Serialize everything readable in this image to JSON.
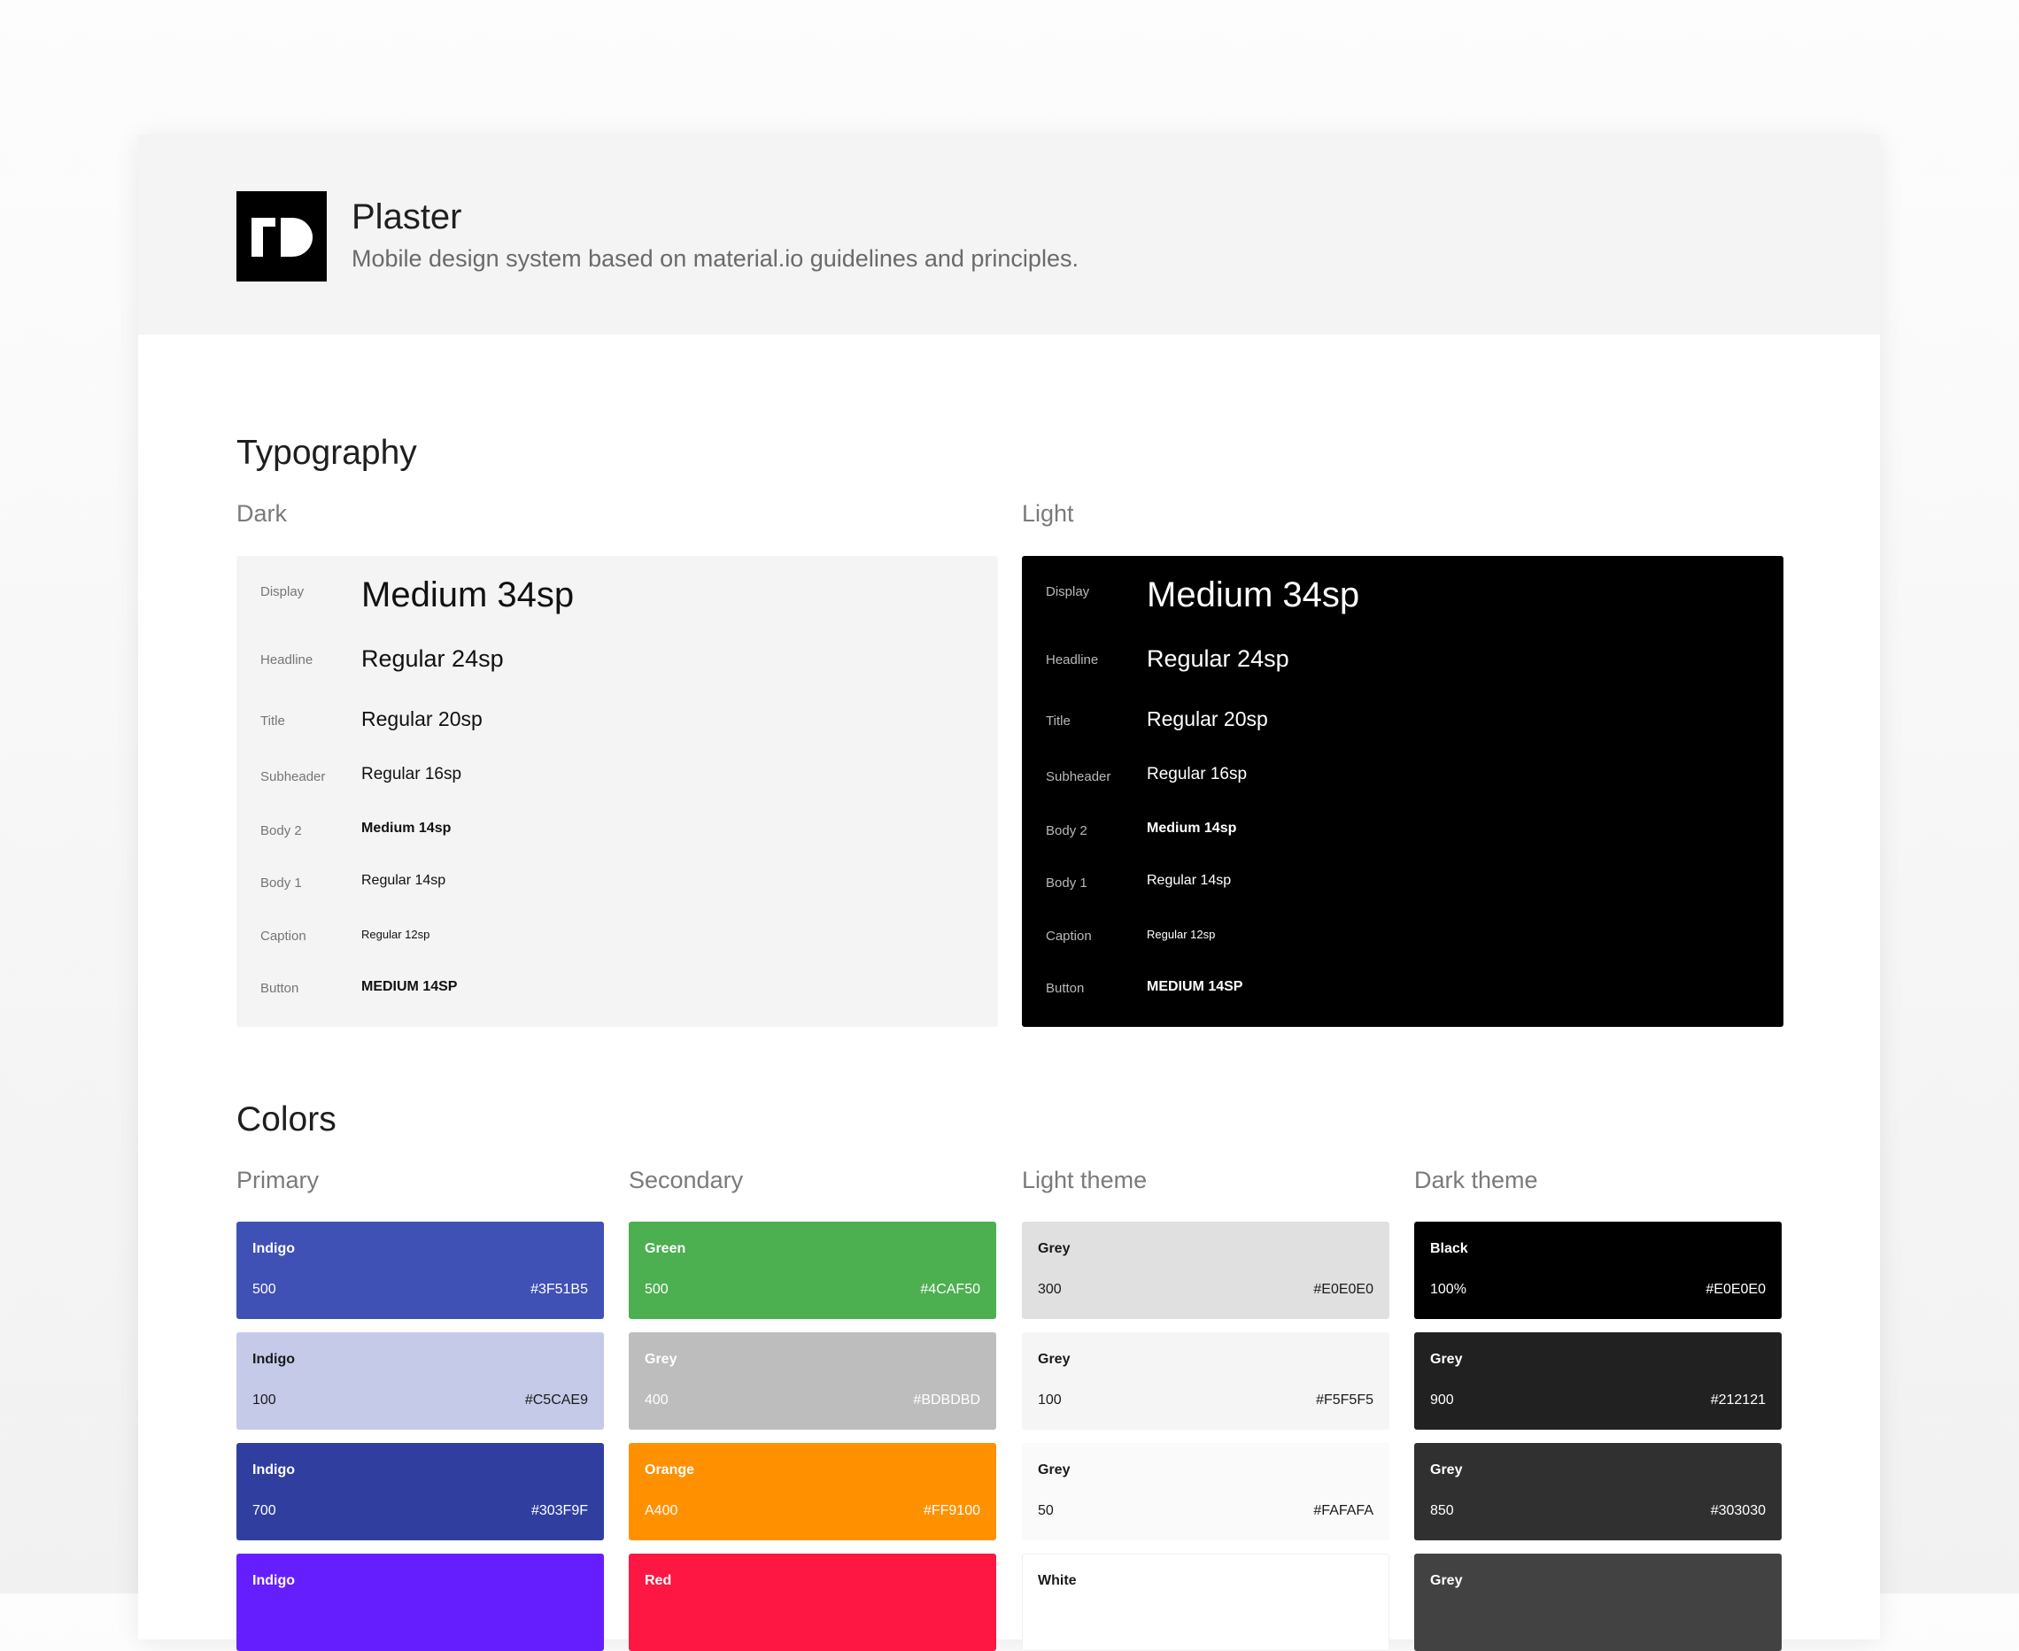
{
  "header": {
    "app_name": "Plaster",
    "description": "Mobile design system based on material.io guidelines and principles.",
    "logo_icon": "plaster-logo-icon"
  },
  "typography": {
    "title": "Typography",
    "dark_label": "Dark",
    "light_label": "Light",
    "rows": [
      {
        "label": "Display",
        "sample": "Medium 34sp"
      },
      {
        "label": "Headline",
        "sample": "Regular 24sp"
      },
      {
        "label": "Title",
        "sample": "Regular 20sp"
      },
      {
        "label": "Subheader",
        "sample": "Regular 16sp"
      },
      {
        "label": "Body 2",
        "sample": "Medium 14sp"
      },
      {
        "label": "Body 1",
        "sample": "Regular 14sp"
      },
      {
        "label": "Caption",
        "sample": "Regular 12sp"
      },
      {
        "label": "Button",
        "sample": "MEDIUM 14SP"
      }
    ]
  },
  "colors": {
    "title": "Colors",
    "groups": [
      {
        "label": "Primary",
        "swatches": [
          {
            "name": "Indigo",
            "shade": "500",
            "hex": "#3F51B5",
            "bg": "#3F51B5",
            "fg": "#ffffff"
          },
          {
            "name": "Indigo",
            "shade": "100",
            "hex": "#C5CAE9",
            "bg": "#C5CAE9",
            "fg": "#1a1a1a"
          },
          {
            "name": "Indigo",
            "shade": "700",
            "hex": "#303F9F",
            "bg": "#303F9F",
            "fg": "#ffffff"
          },
          {
            "name": "Indigo",
            "shade": "",
            "hex": "",
            "bg": "#651FFF",
            "fg": "#ffffff"
          }
        ]
      },
      {
        "label": "Secondary",
        "swatches": [
          {
            "name": "Green",
            "shade": "500",
            "hex": "#4CAF50",
            "bg": "#4CAF50",
            "fg": "#ffffff"
          },
          {
            "name": "Grey",
            "shade": "400",
            "hex": "#BDBDBD",
            "bg": "#BDBDBD",
            "fg": "#ffffff"
          },
          {
            "name": "Orange",
            "shade": "A400",
            "hex": "#FF9100",
            "bg": "#FF9100",
            "fg": "#ffffff"
          },
          {
            "name": "Red",
            "shade": "",
            "hex": "",
            "bg": "#FF1744",
            "fg": "#ffffff"
          }
        ]
      },
      {
        "label": "Light theme",
        "swatches": [
          {
            "name": "Grey",
            "shade": "300",
            "hex": "#E0E0E0",
            "bg": "#E0E0E0",
            "fg": "#1a1a1a"
          },
          {
            "name": "Grey",
            "shade": "100",
            "hex": "#F5F5F5",
            "bg": "#F5F5F5",
            "fg": "#1a1a1a"
          },
          {
            "name": "Grey",
            "shade": "50",
            "hex": "#FAFAFA",
            "bg": "#FAFAFA",
            "fg": "#1a1a1a"
          },
          {
            "name": "White",
            "shade": "",
            "hex": "",
            "bg": "#FFFFFF",
            "fg": "#1a1a1a"
          }
        ]
      },
      {
        "label": "Dark theme",
        "swatches": [
          {
            "name": "Black",
            "shade": "100%",
            "hex": "#E0E0E0",
            "bg": "#000000",
            "fg": "#ffffff"
          },
          {
            "name": "Grey",
            "shade": "900",
            "hex": "#212121",
            "bg": "#212121",
            "fg": "#ffffff"
          },
          {
            "name": "Grey",
            "shade": "850",
            "hex": "#303030",
            "bg": "#303030",
            "fg": "#ffffff"
          },
          {
            "name": "Grey",
            "shade": "",
            "hex": "",
            "bg": "#424242",
            "fg": "#ffffff"
          }
        ]
      }
    ]
  }
}
